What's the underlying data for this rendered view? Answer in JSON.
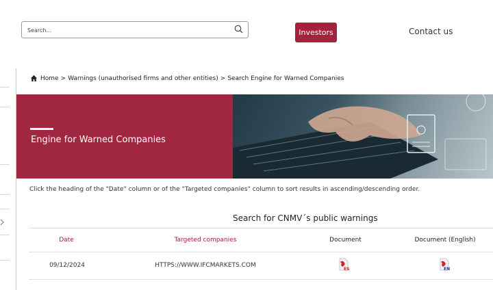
{
  "header": {
    "search_placeholder": "Search...",
    "investors_label": "Investors",
    "contact_label": "Contact us"
  },
  "breadcrumb": {
    "home": "Home",
    "sep1": ">",
    "item2": "Warnings (unauthorised firms and other entities)",
    "sep2": ">",
    "item3": "Search Engine for Warned Companies"
  },
  "banner": {
    "title": "Engine for Warned Companies"
  },
  "instructions": "Click the heading of the \"Date\" column or of the \"Targeted companies\" column to sort results in ascending/descending order.",
  "table": {
    "title": "Search for CNMV´s public warnings",
    "headers": [
      "Date",
      "Targeted companies",
      "Document",
      "Document (English)"
    ],
    "rows": [
      {
        "date": "09/12/2024",
        "company": "HTTPS://WWW.IFCMARKETS.COM",
        "doc_icon": "pdf-es-icon",
        "doc_en_icon": "pdf-en-icon"
      }
    ]
  },
  "colors": {
    "accent": "#a3223c",
    "banner": "#a12640"
  },
  "icons": [
    "search-icon",
    "home-icon",
    "chevron-right-icon",
    "pdf-es-icon",
    "pdf-en-icon"
  ]
}
